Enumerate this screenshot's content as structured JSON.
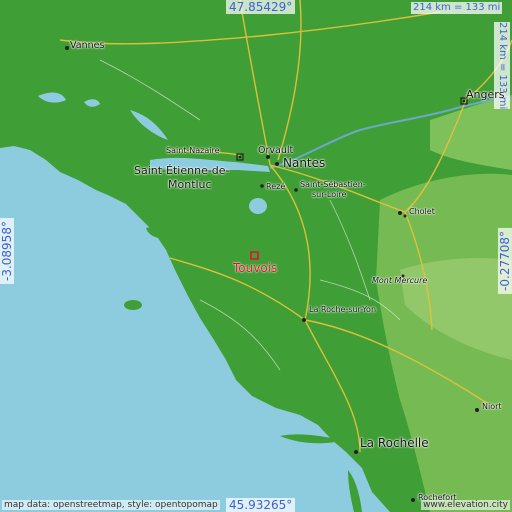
{
  "map": {
    "coords": {
      "top": "47.85429°",
      "bottom": "45.93265°",
      "left": "-3.08958°",
      "right": "-0.27708°"
    },
    "scale": {
      "horizontal": "214 km = 133 mi",
      "vertical": "214 km = 133 mi"
    },
    "target": {
      "name": "Touvois"
    },
    "cities": [
      {
        "key": "vannes",
        "label": "Vannes"
      },
      {
        "key": "angers",
        "label": "Angers"
      },
      {
        "key": "orvault",
        "label": "Orvault"
      },
      {
        "key": "nantes",
        "label": "Nantes"
      },
      {
        "key": "saint_nazaire",
        "label": "Saint-Nazaire"
      },
      {
        "key": "saint_etienne_1",
        "label": "Saint-Étienne-de-"
      },
      {
        "key": "saint_etienne_2",
        "label": "Montluc"
      },
      {
        "key": "reze",
        "label": "Rezé"
      },
      {
        "key": "saint_sebastien_1",
        "label": "Saint-Sébastien-"
      },
      {
        "key": "saint_sebastien_2",
        "label": "sur-Loire"
      },
      {
        "key": "cholet",
        "label": "Cholet"
      },
      {
        "key": "mont_mercure",
        "label": "Mont Mercure"
      },
      {
        "key": "la_roche",
        "label": "La Roche-sur-Yon"
      },
      {
        "key": "niort",
        "label": "Niort"
      },
      {
        "key": "la_rochelle",
        "label": "La Rochelle"
      },
      {
        "key": "rochefort",
        "label": "Rochefort"
      }
    ],
    "credits": {
      "left": "map data: openstreetmap, style: opentopomap",
      "right": "www.elevation.city"
    },
    "colors": {
      "sea": "#8dccdf",
      "land_green": "#3f9e35",
      "land_light": "#7fbe57",
      "target_marker": "#e0162a",
      "coord_text": "#3f5fd6"
    }
  }
}
